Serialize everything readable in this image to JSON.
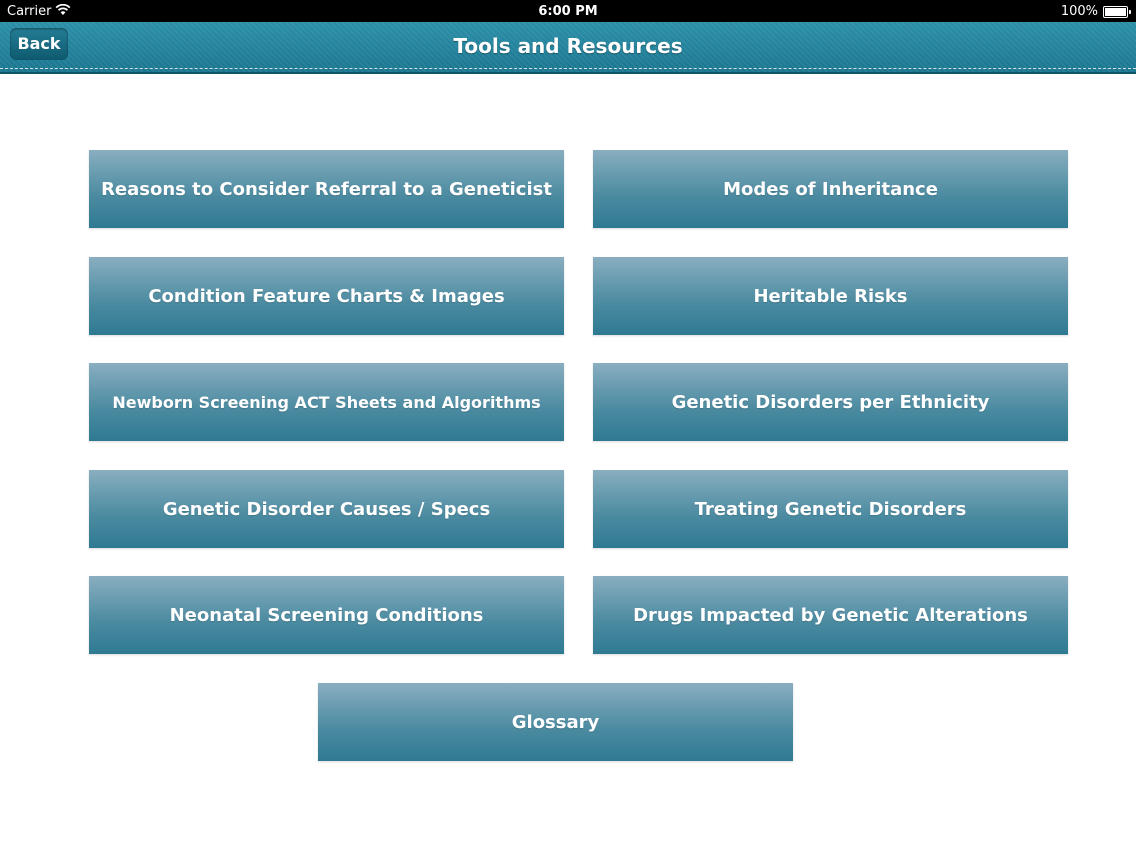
{
  "status_bar": {
    "carrier": "Carrier",
    "time": "6:00 PM",
    "battery": "100%"
  },
  "nav": {
    "back_label": "Back",
    "title": "Tools and Resources"
  },
  "tiles": [
    {
      "label": "Reasons to Consider Referral to a Geneticist"
    },
    {
      "label": "Modes of Inheritance"
    },
    {
      "label": "Condition Feature Charts & Images"
    },
    {
      "label": "Heritable Risks"
    },
    {
      "label": "Newborn Screening ACT Sheets and Algorithms"
    },
    {
      "label": "Genetic Disorders per Ethnicity"
    },
    {
      "label": "Genetic Disorder Causes / Specs"
    },
    {
      "label": "Treating Genetic Disorders"
    },
    {
      "label": "Neonatal Screening Conditions"
    },
    {
      "label": "Drugs Impacted by Genetic Alterations"
    },
    {
      "label": "Glossary"
    }
  ]
}
